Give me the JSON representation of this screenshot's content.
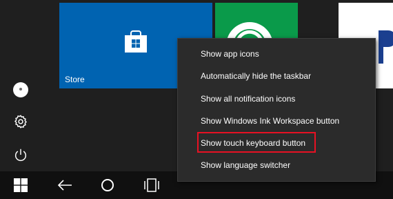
{
  "start": {
    "tiles": {
      "store": {
        "label": "Store",
        "color": "#0063b1"
      },
      "green": {
        "color": "#0a9a4a"
      },
      "white": {
        "color": "#ffffff"
      }
    },
    "rail": {
      "user_icon": "user-avatar-icon",
      "settings_icon": "gear-icon",
      "power_icon": "power-icon"
    }
  },
  "taskbar": {
    "icons": [
      "windows-logo-icon",
      "back-arrow-icon",
      "circle-home-icon",
      "task-view-icon"
    ]
  },
  "context_menu": {
    "items": [
      {
        "label": "Show app icons"
      },
      {
        "label": "Automatically hide the taskbar"
      },
      {
        "label": "Show all notification icons"
      },
      {
        "label": "Show Windows Ink Workspace button"
      },
      {
        "label": "Show touch keyboard button",
        "highlighted": true
      },
      {
        "label": "Show language switcher"
      }
    ],
    "highlight_color": "#e81123"
  }
}
